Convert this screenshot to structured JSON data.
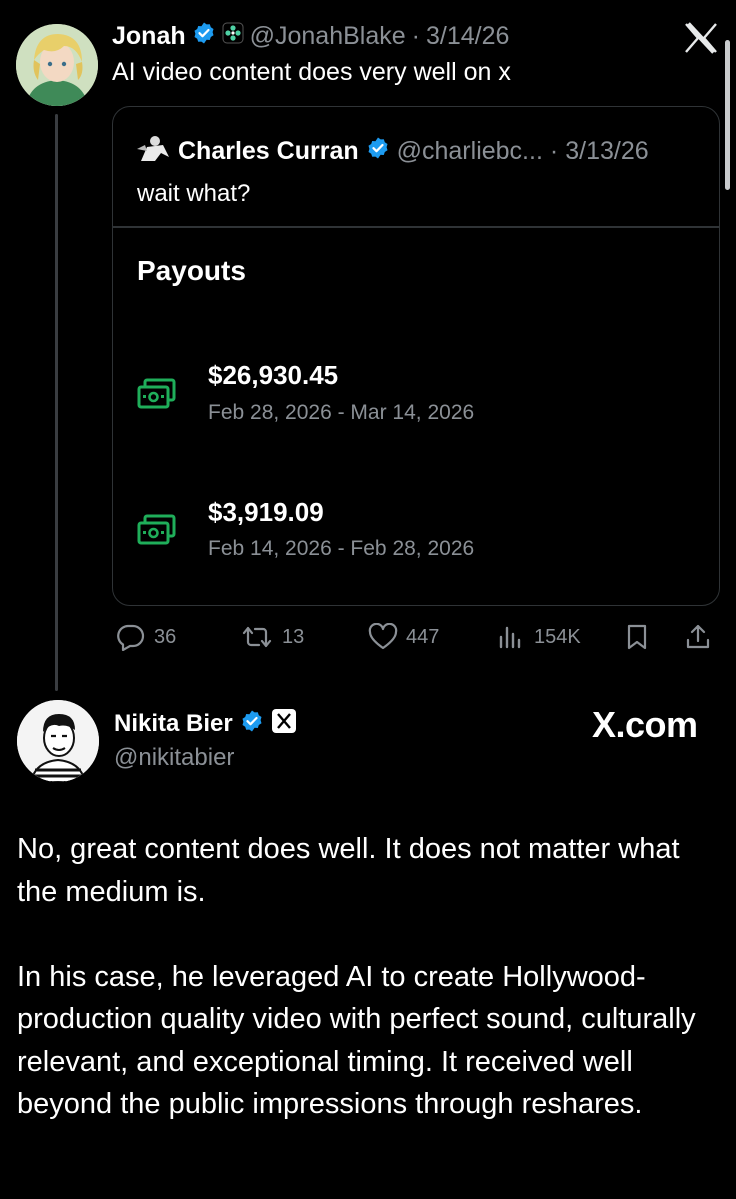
{
  "original_post": {
    "author_name": "Jonah",
    "handle": "@JonahBlake",
    "separator": "·",
    "date": "3/14/26",
    "text": "AI video content does very well on x"
  },
  "quoted_post": {
    "author_name": "Charles Curran",
    "handle": "@charliebc...",
    "separator": "·",
    "date": "3/13/26",
    "text": "wait what?",
    "payouts_title": "Payouts",
    "payouts": [
      {
        "amount": "$26,930.45",
        "range": "Feb 28, 2026 - Mar 14, 2026"
      },
      {
        "amount": "$3,919.09",
        "range": "Feb 14, 2026 - Feb 28, 2026"
      }
    ]
  },
  "actions": {
    "replies": "36",
    "reposts": "13",
    "likes": "447",
    "views": "154K"
  },
  "reply_post": {
    "author_name": "Nikita Bier",
    "handle": "@nikitabier",
    "watermark": "X.com",
    "paragraphs": [
      "No, great content does well. It does not matter what the medium is.",
      "In his case, he leveraged AI to create Hollywood-production quality video with perfect sound, culturally relevant, and exceptional timing. It received well beyond the public impressions through reshares."
    ]
  },
  "colors": {
    "background": "#000000",
    "text": "#e7e9ea",
    "muted": "#8b9096",
    "verified": "#1d9bf0",
    "money_green": "#1fae5a",
    "border": "#2f3336"
  }
}
